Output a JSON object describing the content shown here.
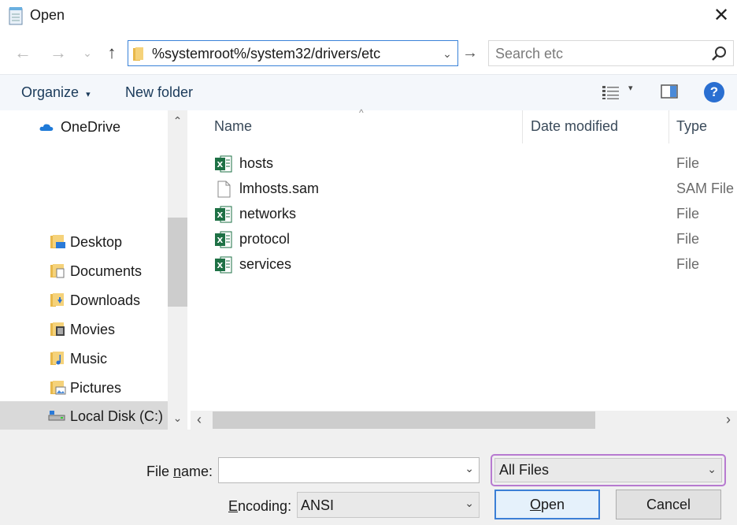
{
  "window": {
    "title": "Open",
    "close_label": "✕"
  },
  "navigation": {
    "back": "←",
    "forward": "→",
    "recent": "⌄",
    "up": "↑",
    "address": "%systemroot%/system32/drivers/etc",
    "go": "→",
    "search_placeholder": "Search etc"
  },
  "toolbar": {
    "organize": "Organize",
    "organize_caret": "▾",
    "new_folder": "New folder",
    "view_caret": "▾",
    "help": "?"
  },
  "nav_pane": {
    "items": [
      {
        "label": "OneDrive",
        "icon": "cloud-icon"
      },
      {
        "label": "Desktop",
        "icon": "desktop-folder-icon"
      },
      {
        "label": "Documents",
        "icon": "documents-folder-icon"
      },
      {
        "label": "Downloads",
        "icon": "downloads-folder-icon"
      },
      {
        "label": "Movies",
        "icon": "movies-folder-icon"
      },
      {
        "label": "Music",
        "icon": "music-folder-icon"
      },
      {
        "label": "Pictures",
        "icon": "pictures-folder-icon"
      },
      {
        "label": "Local Disk (C:)",
        "icon": "drive-icon",
        "selected": true
      }
    ],
    "scroll_up": "⌃",
    "scroll_down": "⌄"
  },
  "file_list": {
    "columns": {
      "name": "Name",
      "date_modified": "Date modified",
      "type": "Type"
    },
    "sort_indicator": "^",
    "files": [
      {
        "name": "hosts",
        "type": "File",
        "icon": "excel-file-icon"
      },
      {
        "name": "lmhosts.sam",
        "type": "SAM File",
        "icon": "blank-file-icon"
      },
      {
        "name": "networks",
        "type": "File",
        "icon": "excel-file-icon"
      },
      {
        "name": "protocol",
        "type": "File",
        "icon": "excel-file-icon"
      },
      {
        "name": "services",
        "type": "File",
        "icon": "excel-file-icon"
      }
    ],
    "hscroll_left": "‹",
    "hscroll_right": "›"
  },
  "bottom": {
    "file_name_label_pre": "File ",
    "file_name_label_key": "n",
    "file_name_label_post": "ame:",
    "file_name_value": "",
    "filter_value": "All Files",
    "encoding_label_key": "E",
    "encoding_label_post": "ncoding:",
    "encoding_value": "ANSI",
    "open_key": "O",
    "open_post": "pen",
    "cancel_label": "Cancel",
    "dropdown_arrow": "⌄"
  },
  "colors": {
    "accent": "#3b7fd6",
    "filter_highlight": "#b77ad0",
    "help": "#2a6fd1"
  }
}
